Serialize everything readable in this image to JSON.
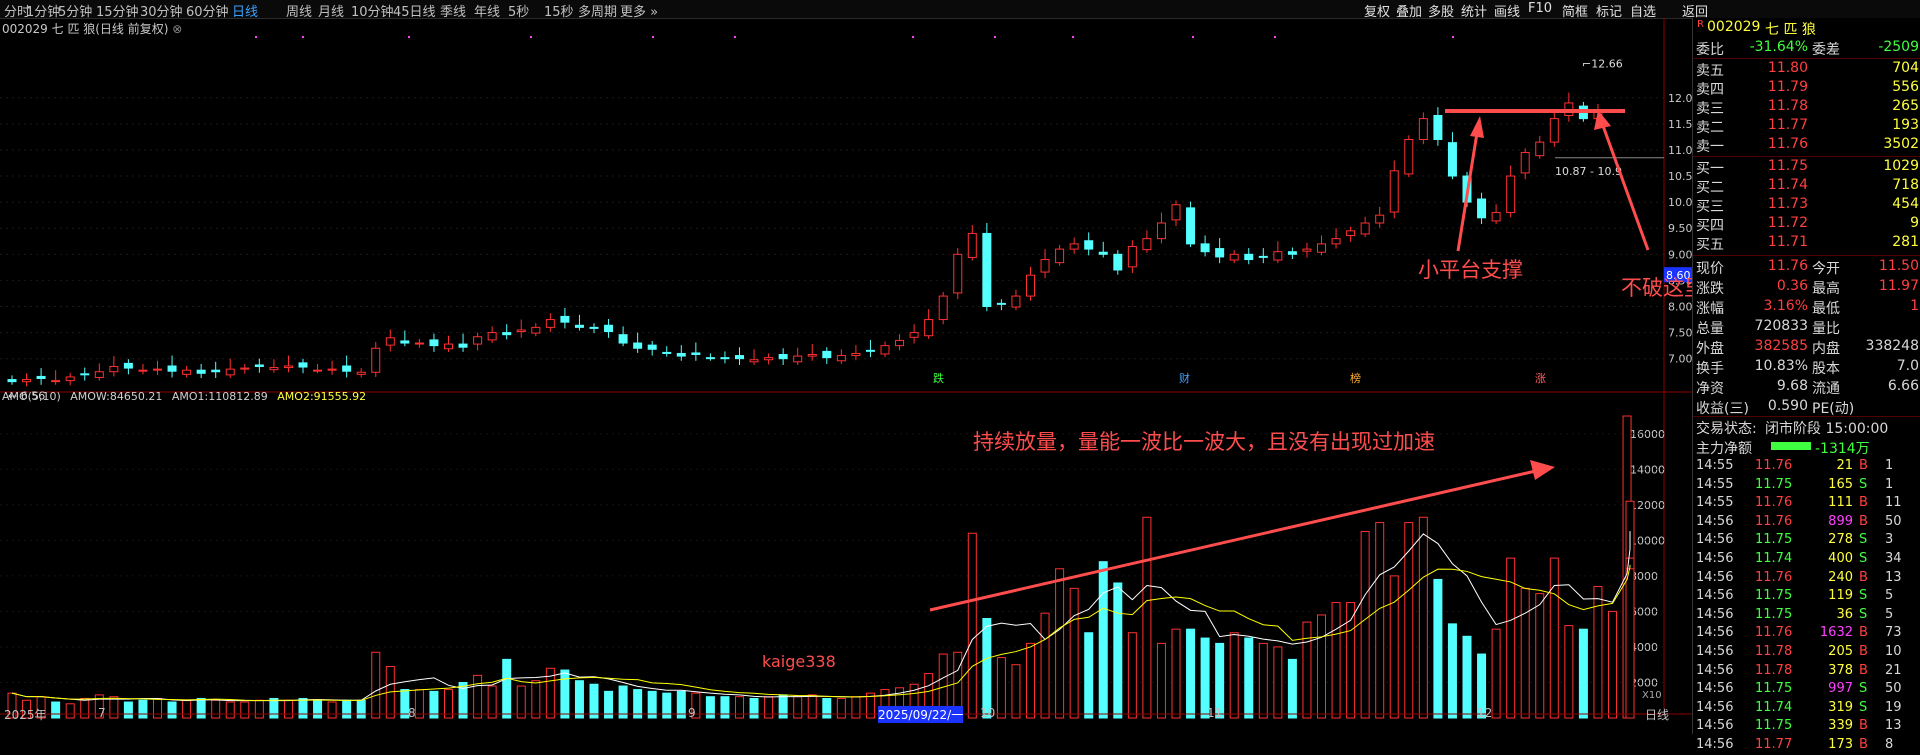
{
  "toolbar": {
    "periods": [
      "分时",
      "1分钟",
      "5分钟",
      "15分钟",
      "30分钟",
      "60分钟",
      "日线",
      "周线",
      "月线",
      "10分钟",
      "45日线",
      "季线",
      "年线",
      "5秒",
      "15秒",
      "多周期",
      "更多"
    ],
    "active_period": "日线",
    "right_tools": [
      "复权",
      "叠加",
      "多股",
      "统计",
      "画线",
      "F10",
      "简框",
      "标记",
      "自选",
      "返回"
    ]
  },
  "chart_header": {
    "title": "002029 七 匹 狼(日线 前复权)"
  },
  "price_axis": {
    "ticks": [
      "12.00",
      "11.50",
      "11.00",
      "10.50",
      "10.00",
      "9.50",
      "9.00",
      "8.50",
      "8.00",
      "7.50",
      "7.00"
    ],
    "marker": "8.60"
  },
  "price_labels": {
    "high": "12.66",
    "low": "6.56",
    "range": "10.87 - 10.9"
  },
  "event_markers": [
    "跌",
    "财",
    "榜",
    "涨"
  ],
  "amo": {
    "name": "AMO(5,10)",
    "amow_label": "AMOW:",
    "amow": "84650.21",
    "amo1_label": "AMO1:",
    "amo1": "110812.89",
    "amo2_label": "AMO2:",
    "amo2": "91555.92",
    "ticks": [
      "16000",
      "14000",
      "12000",
      "10000",
      "8000",
      "6000",
      "4000",
      "2000"
    ],
    "x10": "X10"
  },
  "x_axis": {
    "labels": [
      "2025年",
      "7",
      "8",
      "9",
      "2025/09/22/一",
      "10",
      "11",
      "12"
    ],
    "period": "日线"
  },
  "annotations": {
    "platform": "小平台支撑",
    "no_break": "不破这里持股",
    "volume": "持续放量，量能一波比一波大，且没有出现过加速",
    "watermark": "kaige338"
  },
  "colors": {
    "up": "#ff3030",
    "down": "#54ffff",
    "ma1": "#ffffff",
    "ma2": "#ffff00",
    "annotation": "#ff4d4d"
  },
  "quote": {
    "code": "002029",
    "name": "七 匹 狼",
    "weibi_label": "委比",
    "weibi": "-31.64%",
    "weicha_label": "委差",
    "weicha": "-2509",
    "asks": [
      {
        "label": "卖五",
        "price": "11.80",
        "vol": "704"
      },
      {
        "label": "卖四",
        "price": "11.79",
        "vol": "556"
      },
      {
        "label": "卖三",
        "price": "11.78",
        "vol": "265"
      },
      {
        "label": "卖二",
        "price": "11.77",
        "vol": "193"
      },
      {
        "label": "卖一",
        "price": "11.76",
        "vol": "3502"
      }
    ],
    "bids": [
      {
        "label": "买一",
        "price": "11.75",
        "vol": "1029"
      },
      {
        "label": "买二",
        "price": "11.74",
        "vol": "718"
      },
      {
        "label": "买三",
        "price": "11.73",
        "vol": "454"
      },
      {
        "label": "买四",
        "price": "11.72",
        "vol": "9"
      },
      {
        "label": "买五",
        "price": "11.71",
        "vol": "281"
      }
    ],
    "stats": [
      {
        "l1": "现价",
        "v1": "11.76",
        "l2": "今开",
        "v2": "11.50"
      },
      {
        "l1": "涨跌",
        "v1": "0.36",
        "l2": "最高",
        "v2": "11.97"
      },
      {
        "l1": "涨幅",
        "v1": "3.16%",
        "l2": "最低",
        "v2": "1"
      },
      {
        "l1": "总量",
        "v1": "720833",
        "l2": "量比",
        "v2": ""
      },
      {
        "l1": "外盘",
        "v1": "382585",
        "l2": "内盘",
        "v2": "338248"
      },
      {
        "l1": "换手",
        "v1": "10.83%",
        "l2": "股本",
        "v2": "7.0"
      },
      {
        "l1": "净资",
        "v1": "9.68",
        "l2": "流通",
        "v2": "6.66"
      },
      {
        "l1": "收益(三)",
        "v1": "0.590",
        "l2": "PE(动)",
        "v2": ""
      }
    ],
    "trade_state_label": "交易状态:",
    "trade_state": "闭市阶段 15:00:00",
    "main_flow_label": "主力净额",
    "main_flow": "-1314万"
  },
  "trades": [
    {
      "t": "14:55",
      "p": "11.76",
      "v": "21",
      "s": "B",
      "n": "1"
    },
    {
      "t": "14:55",
      "p": "11.75",
      "v": "165",
      "s": "S",
      "n": "1"
    },
    {
      "t": "14:55",
      "p": "11.76",
      "v": "111",
      "s": "B",
      "n": "11"
    },
    {
      "t": "14:56",
      "p": "11.76",
      "v": "899",
      "s": "B",
      "n": "50"
    },
    {
      "t": "14:56",
      "p": "11.75",
      "v": "278",
      "s": "S",
      "n": "3"
    },
    {
      "t": "14:56",
      "p": "11.74",
      "v": "400",
      "s": "S",
      "n": "34"
    },
    {
      "t": "14:56",
      "p": "11.76",
      "v": "240",
      "s": "B",
      "n": "13"
    },
    {
      "t": "14:56",
      "p": "11.75",
      "v": "119",
      "s": "S",
      "n": "5"
    },
    {
      "t": "14:56",
      "p": "11.75",
      "v": "36",
      "s": "S",
      "n": "5"
    },
    {
      "t": "14:56",
      "p": "11.76",
      "v": "1632",
      "s": "B",
      "n": "73"
    },
    {
      "t": "14:56",
      "p": "11.78",
      "v": "205",
      "s": "B",
      "n": "10"
    },
    {
      "t": "14:56",
      "p": "11.78",
      "v": "378",
      "s": "B",
      "n": "21"
    },
    {
      "t": "14:56",
      "p": "11.75",
      "v": "997",
      "s": "S",
      "n": "50"
    },
    {
      "t": "14:56",
      "p": "11.74",
      "v": "319",
      "s": "S",
      "n": "19"
    },
    {
      "t": "14:56",
      "p": "11.75",
      "v": "339",
      "s": "B",
      "n": "13"
    },
    {
      "t": "14:56",
      "p": "11.77",
      "v": "173",
      "s": "B",
      "n": "8"
    }
  ]
}
